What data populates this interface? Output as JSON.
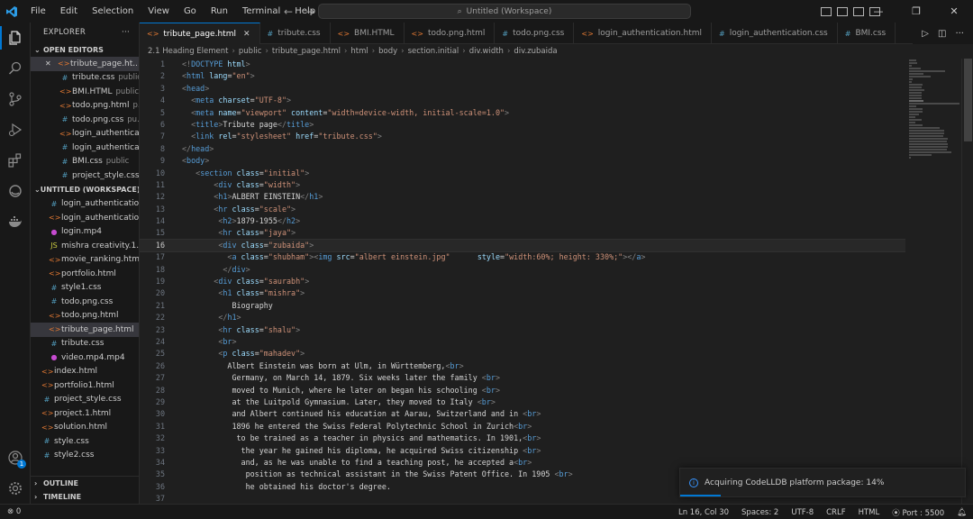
{
  "menu": [
    "File",
    "Edit",
    "Selection",
    "View",
    "Go",
    "Run",
    "Terminal",
    "Help"
  ],
  "command_center": "Untitled (Workspace)",
  "explorer": {
    "title": "EXPLORER",
    "more": "···",
    "open_editors_title": "OPEN EDITORS",
    "open_editors": [
      {
        "name": "tribute_page.ht...",
        "sub": "",
        "type": "html",
        "selected": true,
        "close": "✕"
      },
      {
        "name": "tribute.css",
        "sub": "public",
        "type": "css"
      },
      {
        "name": "BMI.HTML",
        "sub": "public",
        "type": "html"
      },
      {
        "name": "todo.png.html",
        "sub": "p...",
        "type": "html"
      },
      {
        "name": "todo.png.css",
        "sub": "pu...",
        "type": "css"
      },
      {
        "name": "login_authentica...",
        "sub": "",
        "type": "html"
      },
      {
        "name": "login_authentica...",
        "sub": "",
        "type": "css"
      },
      {
        "name": "BMI.css",
        "sub": "public",
        "type": "css"
      },
      {
        "name": "project_style.css",
        "sub": "",
        "type": "css"
      }
    ],
    "workspace_title": "UNTITLED (WORKSPACE)",
    "workspace_files": [
      {
        "name": "login_authenticatio...",
        "type": "css",
        "indent": 2
      },
      {
        "name": "login_authenticatio...",
        "type": "html",
        "indent": 2
      },
      {
        "name": "login.mp4",
        "type": "mp4",
        "indent": 2
      },
      {
        "name": "mishra creativity.1.j...",
        "type": "js",
        "indent": 2
      },
      {
        "name": "movie_ranking.html",
        "type": "html",
        "indent": 2
      },
      {
        "name": "portfolio.html",
        "type": "html",
        "indent": 2
      },
      {
        "name": "style1.css",
        "type": "css",
        "indent": 2
      },
      {
        "name": "todo.png.css",
        "type": "css",
        "indent": 2
      },
      {
        "name": "todo.png.html",
        "type": "html",
        "indent": 2
      },
      {
        "name": "tribute_page.html",
        "type": "html",
        "indent": 2,
        "selected": true
      },
      {
        "name": "tribute.css",
        "type": "css",
        "indent": 2
      },
      {
        "name": "video.mp4.mp4",
        "type": "mp4",
        "indent": 2
      },
      {
        "name": "index.html",
        "type": "html",
        "indent": 1
      },
      {
        "name": "portfolio1.html",
        "type": "html",
        "indent": 1
      },
      {
        "name": "project_style.css",
        "type": "css",
        "indent": 1
      },
      {
        "name": "project.1.html",
        "type": "html",
        "indent": 1
      },
      {
        "name": "solution.html",
        "type": "html",
        "indent": 1
      },
      {
        "name": "style.css",
        "type": "css",
        "indent": 1
      },
      {
        "name": "style2.css",
        "type": "css",
        "indent": 1
      }
    ],
    "outline_title": "OUTLINE",
    "timeline_title": "TIMELINE"
  },
  "tabs": [
    {
      "name": "tribute_page.html",
      "type": "html",
      "active": true,
      "close": "✕"
    },
    {
      "name": "tribute.css",
      "type": "css"
    },
    {
      "name": "BMI.HTML",
      "type": "html"
    },
    {
      "name": "todo.png.html",
      "type": "html"
    },
    {
      "name": "todo.png.css",
      "type": "css"
    },
    {
      "name": "login_authentication.html",
      "type": "html"
    },
    {
      "name": "login_authentication.css",
      "type": "css"
    },
    {
      "name": "BMI.css",
      "type": "css"
    }
  ],
  "breadcrumb": [
    "2.1 Heading Element",
    "public",
    "tribute_page.html",
    "html",
    "body",
    "section.initial",
    "div.width",
    "div.zubaida"
  ],
  "editor": {
    "current_line": 16,
    "lines": [
      [
        [
          "b",
          "<!"
        ],
        [
          "t",
          "DOCTYPE"
        ],
        [
          "a",
          " html"
        ],
        [
          "b",
          ">"
        ]
      ],
      [
        [
          "b",
          "<"
        ],
        [
          "t",
          "html"
        ],
        [
          "a",
          " lang"
        ],
        [
          "x",
          "="
        ],
        [
          "s",
          "\"en\""
        ],
        [
          "b",
          ">"
        ]
      ],
      [
        [
          "b",
          "<"
        ],
        [
          "t",
          "head"
        ],
        [
          "b",
          ">"
        ]
      ],
      [
        [
          "x",
          "  "
        ],
        [
          "b",
          "<"
        ],
        [
          "t",
          "meta"
        ],
        [
          "a",
          " charset"
        ],
        [
          "x",
          "="
        ],
        [
          "s",
          "\"UTF-8\""
        ],
        [
          "b",
          ">"
        ]
      ],
      [
        [
          "x",
          "  "
        ],
        [
          "b",
          "<"
        ],
        [
          "t",
          "meta"
        ],
        [
          "a",
          " name"
        ],
        [
          "x",
          "="
        ],
        [
          "s",
          "\"viewport\""
        ],
        [
          "a",
          " content"
        ],
        [
          "x",
          "="
        ],
        [
          "s",
          "\"width=device-width, initial-scale=1.0\""
        ],
        [
          "b",
          ">"
        ]
      ],
      [
        [
          "x",
          "  "
        ],
        [
          "b",
          "<"
        ],
        [
          "t",
          "title"
        ],
        [
          "b",
          ">"
        ],
        [
          "x",
          "Tribute page"
        ],
        [
          "b",
          "</"
        ],
        [
          "t",
          "title"
        ],
        [
          "b",
          ">"
        ]
      ],
      [
        [
          "x",
          "  "
        ],
        [
          "b",
          "<"
        ],
        [
          "t",
          "link"
        ],
        [
          "a",
          " rel"
        ],
        [
          "x",
          "="
        ],
        [
          "s",
          "\"stylesheet\""
        ],
        [
          "a",
          " href"
        ],
        [
          "x",
          "="
        ],
        [
          "s",
          "\"tribute.css\""
        ],
        [
          "b",
          ">"
        ]
      ],
      [
        [
          "b",
          "</"
        ],
        [
          "t",
          "head"
        ],
        [
          "b",
          ">"
        ]
      ],
      [
        [
          "b",
          "<"
        ],
        [
          "t",
          "body"
        ],
        [
          "b",
          ">"
        ]
      ],
      [
        [
          "x",
          "   "
        ],
        [
          "b",
          "<"
        ],
        [
          "t",
          "section"
        ],
        [
          "a",
          " class"
        ],
        [
          "x",
          "="
        ],
        [
          "s",
          "\"initial\""
        ],
        [
          "b",
          ">"
        ]
      ],
      [
        [
          "x",
          "       "
        ],
        [
          "b",
          "<"
        ],
        [
          "t",
          "div"
        ],
        [
          "a",
          " class"
        ],
        [
          "x",
          "="
        ],
        [
          "s",
          "\"width\""
        ],
        [
          "b",
          ">"
        ]
      ],
      [
        [
          "x",
          "       "
        ],
        [
          "b",
          "<"
        ],
        [
          "t",
          "h1"
        ],
        [
          "b",
          ">"
        ],
        [
          "x",
          "ALBERT EINSTEIN"
        ],
        [
          "b",
          "</"
        ],
        [
          "t",
          "h1"
        ],
        [
          "b",
          ">"
        ]
      ],
      [
        [
          "x",
          "       "
        ],
        [
          "b",
          "<"
        ],
        [
          "t",
          "hr"
        ],
        [
          "a",
          " class"
        ],
        [
          "x",
          "="
        ],
        [
          "s",
          "\"scale\""
        ],
        [
          "b",
          ">"
        ]
      ],
      [
        [
          "x",
          "        "
        ],
        [
          "b",
          "<"
        ],
        [
          "t",
          "h2"
        ],
        [
          "b",
          ">"
        ],
        [
          "x",
          "1879-1955"
        ],
        [
          "b",
          "</"
        ],
        [
          "t",
          "h2"
        ],
        [
          "b",
          ">"
        ]
      ],
      [
        [
          "x",
          "        "
        ],
        [
          "b",
          "<"
        ],
        [
          "t",
          "hr"
        ],
        [
          "a",
          " class"
        ],
        [
          "x",
          "="
        ],
        [
          "s",
          "\"jaya\""
        ],
        [
          "b",
          ">"
        ]
      ],
      [
        [
          "x",
          "        "
        ],
        [
          "b",
          "<"
        ],
        [
          "t",
          "div"
        ],
        [
          "a",
          " class"
        ],
        [
          "x",
          "="
        ],
        [
          "s",
          "\"zubaida\""
        ],
        [
          "b",
          ">"
        ]
      ],
      [
        [
          "x",
          "          "
        ],
        [
          "b",
          "<"
        ],
        [
          "t",
          "a"
        ],
        [
          "a",
          " class"
        ],
        [
          "x",
          "="
        ],
        [
          "s",
          "\"shubham\""
        ],
        [
          "b",
          "><"
        ],
        [
          "t",
          "img"
        ],
        [
          "a",
          " src"
        ],
        [
          "x",
          "="
        ],
        [
          "s",
          "\"albert einstein.jpg\""
        ],
        [
          "x",
          "      "
        ],
        [
          "a",
          "style"
        ],
        [
          "x",
          "="
        ],
        [
          "s",
          "\"width:60%; height: 330%;\""
        ],
        [
          "b",
          "></"
        ],
        [
          "t",
          "a"
        ],
        [
          "b",
          ">"
        ]
      ],
      [
        [
          "x",
          "         "
        ],
        [
          "b",
          "</"
        ],
        [
          "t",
          "div"
        ],
        [
          "b",
          ">"
        ]
      ],
      [
        [
          "x",
          "       "
        ],
        [
          "b",
          "<"
        ],
        [
          "t",
          "div"
        ],
        [
          "a",
          " class"
        ],
        [
          "x",
          "="
        ],
        [
          "s",
          "\"saurabh\""
        ],
        [
          "b",
          ">"
        ]
      ],
      [
        [
          "x",
          "        "
        ],
        [
          "b",
          "<"
        ],
        [
          "t",
          "h1"
        ],
        [
          "a",
          " class"
        ],
        [
          "x",
          "="
        ],
        [
          "s",
          "\"mishra\""
        ],
        [
          "b",
          ">"
        ]
      ],
      [
        [
          "x",
          "           Biography"
        ]
      ],
      [
        [
          "x",
          "        "
        ],
        [
          "b",
          "</"
        ],
        [
          "t",
          "h1"
        ],
        [
          "b",
          ">"
        ]
      ],
      [
        [
          "x",
          "        "
        ],
        [
          "b",
          "<"
        ],
        [
          "t",
          "hr"
        ],
        [
          "a",
          " class"
        ],
        [
          "x",
          "="
        ],
        [
          "s",
          "\"shalu\""
        ],
        [
          "b",
          ">"
        ]
      ],
      [
        [
          "x",
          "        "
        ],
        [
          "b",
          "<"
        ],
        [
          "t",
          "br"
        ],
        [
          "b",
          ">"
        ]
      ],
      [
        [
          "x",
          "        "
        ],
        [
          "b",
          "<"
        ],
        [
          "t",
          "p"
        ],
        [
          "a",
          " class"
        ],
        [
          "x",
          "="
        ],
        [
          "s",
          "\"mahadev\""
        ],
        [
          "b",
          ">"
        ]
      ],
      [
        [
          "x",
          "          Albert Einstein was born at Ulm, in Württemberg,"
        ],
        [
          "b",
          "<"
        ],
        [
          "t",
          "br"
        ],
        [
          "b",
          ">"
        ]
      ],
      [
        [
          "x",
          "           Germany, on March 14, 1879. Six weeks later the family "
        ],
        [
          "b",
          "<"
        ],
        [
          "t",
          "br"
        ],
        [
          "b",
          ">"
        ]
      ],
      [
        [
          "x",
          "           moved to Munich, where he later on began his schooling "
        ],
        [
          "b",
          "<"
        ],
        [
          "t",
          "br"
        ],
        [
          "b",
          ">"
        ]
      ],
      [
        [
          "x",
          "           at the Luitpold Gymnasium. Later, they moved to Italy "
        ],
        [
          "b",
          "<"
        ],
        [
          "t",
          "br"
        ],
        [
          "b",
          ">"
        ]
      ],
      [
        [
          "x",
          "           and Albert continued his education at Aarau, Switzerland and in "
        ],
        [
          "b",
          "<"
        ],
        [
          "t",
          "br"
        ],
        [
          "b",
          ">"
        ]
      ],
      [
        [
          "x",
          "           1896 he entered the Swiss Federal Polytechnic School in Zurich"
        ],
        [
          "b",
          "<"
        ],
        [
          "t",
          "br"
        ],
        [
          "b",
          ">"
        ]
      ],
      [
        [
          "x",
          "            to be trained as a teacher in physics and mathematics. In 1901,"
        ],
        [
          "b",
          "<"
        ],
        [
          "t",
          "br"
        ],
        [
          "b",
          ">"
        ]
      ],
      [
        [
          "x",
          "             the year he gained his diploma, he acquired Swiss citizenship "
        ],
        [
          "b",
          "<"
        ],
        [
          "t",
          "br"
        ],
        [
          "b",
          ">"
        ]
      ],
      [
        [
          "x",
          "             and, as he was unable to find a teaching post, he accepted a"
        ],
        [
          "b",
          "<"
        ],
        [
          "t",
          "br"
        ],
        [
          "b",
          ">"
        ]
      ],
      [
        [
          "x",
          "              position as technical assistant in the Swiss Patent Office. In 1905 "
        ],
        [
          "b",
          "<"
        ],
        [
          "t",
          "br"
        ],
        [
          "b",
          ">"
        ]
      ],
      [
        [
          "x",
          "              he obtained his doctor's degree."
        ]
      ],
      [
        [
          "x",
          ""
        ]
      ]
    ]
  },
  "notification": {
    "text": "Acquiring CodeLLDB platform package: 14%",
    "progress": 0.14
  },
  "statusbar": {
    "remote": "⊗ 0",
    "position": "Ln 16, Col 30",
    "spaces": "Spaces: 2",
    "encoding": "UTF-8",
    "eol": "CRLF",
    "language": "HTML",
    "port": "⦿ Port : 5500"
  },
  "accounts_badge": "1",
  "colors": {
    "accent": "#0078d4",
    "tag": "#569cd6",
    "attr": "#9cdcfe",
    "string": "#ce9178"
  }
}
